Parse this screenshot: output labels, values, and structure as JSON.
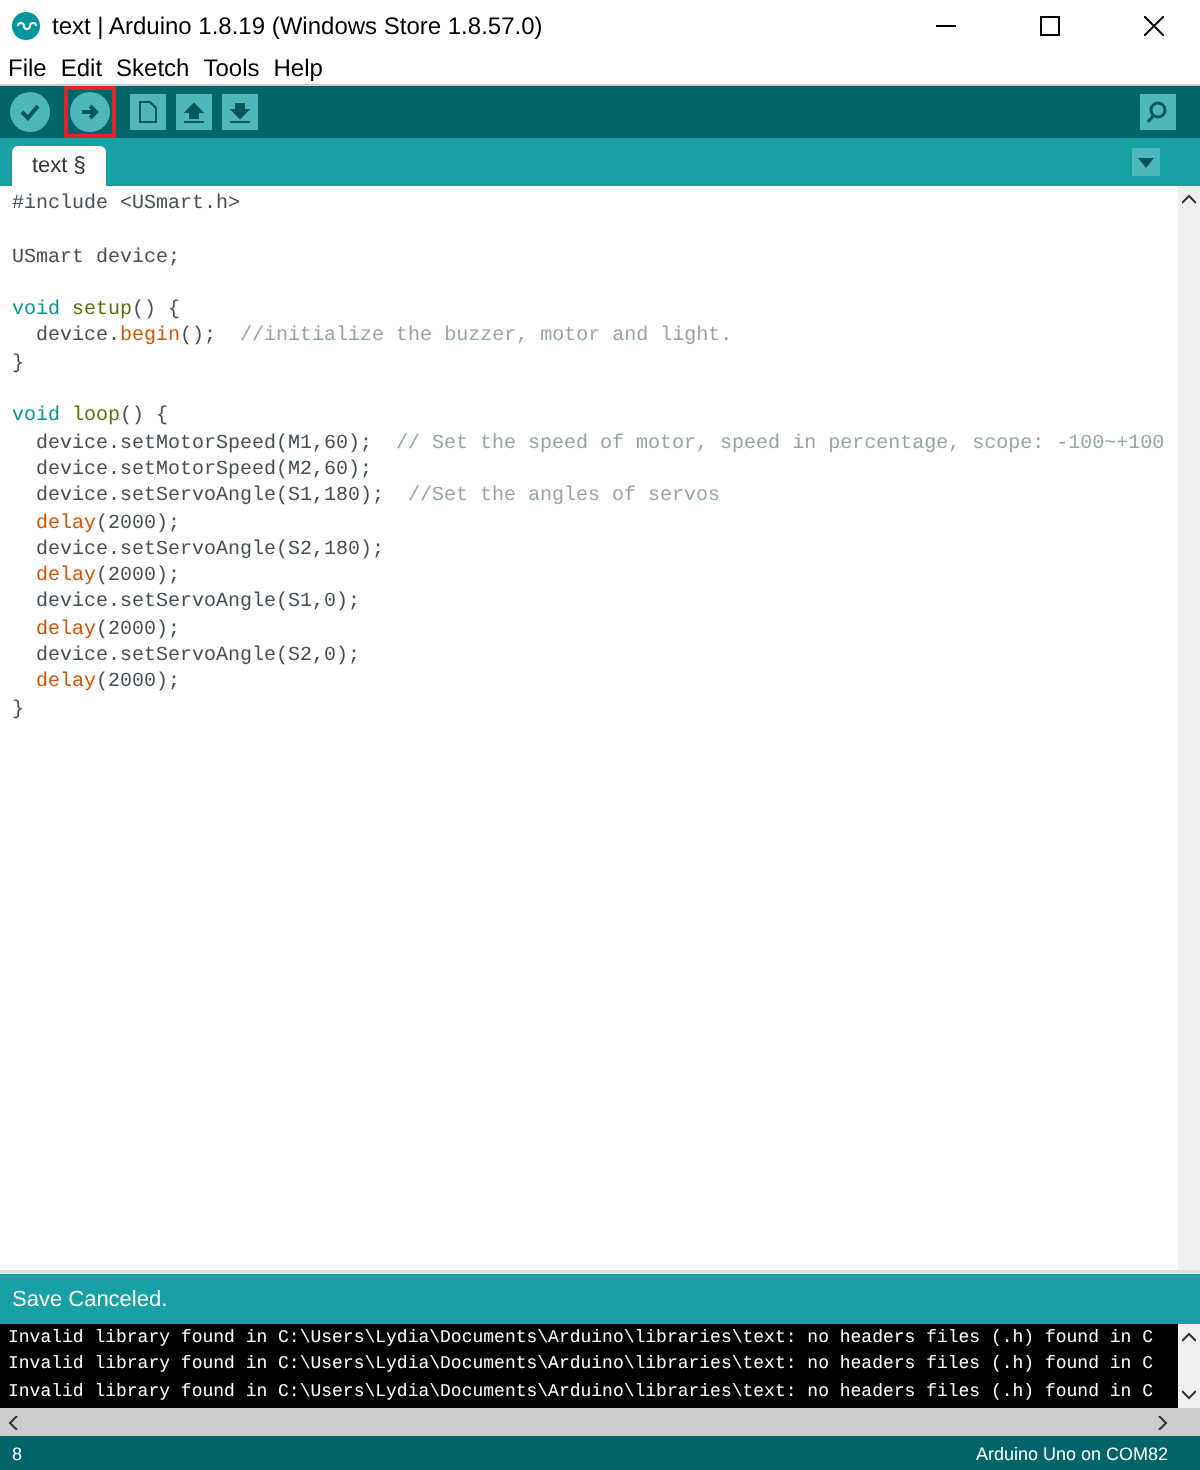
{
  "window": {
    "title": "text | Arduino 1.8.19 (Windows Store 1.8.57.0)"
  },
  "menu": [
    "File",
    "Edit",
    "Sketch",
    "Tools",
    "Help"
  ],
  "toolbar": [
    {
      "kind": "verify",
      "highlighted": false
    },
    {
      "kind": "upload",
      "highlighted": true
    },
    {
      "kind": "new",
      "highlighted": false
    },
    {
      "kind": "open",
      "highlighted": false
    },
    {
      "kind": "save",
      "highlighted": false
    }
  ],
  "tabs": [
    {
      "label": "text §",
      "selected": true
    }
  ],
  "code": [
    {
      "kind": "code",
      "indent": false,
      "segments": [
        {
          "kind": "plain",
          "text": "#include <USmart.h>"
        }
      ]
    },
    {
      "kind": "blank"
    },
    {
      "kind": "code",
      "indent": false,
      "segments": [
        {
          "kind": "plain",
          "text": "USmart device;"
        }
      ]
    },
    {
      "kind": "blank"
    },
    {
      "kind": "code",
      "indent": false,
      "segments": [
        {
          "kind": "keyword",
          "text": "void"
        },
        {
          "kind": "entry",
          "text": "setup"
        },
        {
          "kind": "plain",
          "text": "() {"
        }
      ]
    },
    {
      "kind": "code",
      "indent": true,
      "segments": [
        {
          "kind": "plain",
          "text": "device."
        },
        {
          "kind": "function",
          "text": "begin"
        },
        {
          "kind": "plain",
          "text": "();"
        },
        {
          "kind": "comment",
          "text": "//initialize the buzzer, motor and light."
        }
      ]
    },
    {
      "kind": "code",
      "indent": false,
      "segments": [
        {
          "kind": "plain",
          "text": "}"
        }
      ]
    },
    {
      "kind": "blank"
    },
    {
      "kind": "code",
      "indent": false,
      "segments": [
        {
          "kind": "keyword",
          "text": "void"
        },
        {
          "kind": "entry",
          "text": "loop"
        },
        {
          "kind": "plain",
          "text": "() {"
        }
      ]
    },
    {
      "kind": "code",
      "indent": true,
      "segments": [
        {
          "kind": "plain",
          "text": "device.setMotorSpeed(M1,60);"
        },
        {
          "kind": "comment",
          "text": "// Set the speed of motor, speed in percentage, scope: -100~+100"
        }
      ]
    },
    {
      "kind": "code",
      "indent": true,
      "segments": [
        {
          "kind": "plain",
          "text": "device.setMotorSpeed(M2,60);"
        }
      ]
    },
    {
      "kind": "code",
      "indent": true,
      "segments": [
        {
          "kind": "plain",
          "text": "device.setServoAngle(S1,180);"
        },
        {
          "kind": "comment",
          "text": "//Set the angles of servos"
        }
      ]
    },
    {
      "kind": "code",
      "indent": true,
      "segments": [
        {
          "kind": "function",
          "text": "delay"
        },
        {
          "kind": "plain",
          "text": "(2000);"
        }
      ]
    },
    {
      "kind": "code",
      "indent": true,
      "segments": [
        {
          "kind": "plain",
          "text": "device.setServoAngle(S2,180);"
        }
      ]
    },
    {
      "kind": "code",
      "indent": true,
      "segments": [
        {
          "kind": "function",
          "text": "delay"
        },
        {
          "kind": "plain",
          "text": "(2000);"
        }
      ]
    },
    {
      "kind": "code",
      "indent": true,
      "segments": [
        {
          "kind": "plain",
          "text": "device.setServoAngle(S1,0);"
        }
      ]
    },
    {
      "kind": "code",
      "indent": true,
      "segments": [
        {
          "kind": "function",
          "text": "delay"
        },
        {
          "kind": "plain",
          "text": "(2000);"
        }
      ]
    },
    {
      "kind": "code",
      "indent": true,
      "segments": [
        {
          "kind": "plain",
          "text": "device.setServoAngle(S2,0);"
        }
      ]
    },
    {
      "kind": "code",
      "indent": true,
      "segments": [
        {
          "kind": "function",
          "text": "delay"
        },
        {
          "kind": "plain",
          "text": "(2000);"
        }
      ]
    },
    {
      "kind": "code",
      "indent": false,
      "segments": [
        {
          "kind": "plain",
          "text": "}"
        }
      ]
    }
  ],
  "status_message": "Save Canceled.",
  "console": [
    "Invalid library found in C:\\Users\\Lydia\\Documents\\Arduino\\libraries\\text: no headers files (.h) found in C",
    "Invalid library found in C:\\Users\\Lydia\\Documents\\Arduino\\libraries\\text: no headers files (.h) found in C",
    "Invalid library found in C:\\Users\\Lydia\\Documents\\Arduino\\libraries\\text: no headers files (.h) found in C"
  ],
  "status_bar": {
    "line": "8",
    "board": "Arduino Uno on COM82"
  }
}
